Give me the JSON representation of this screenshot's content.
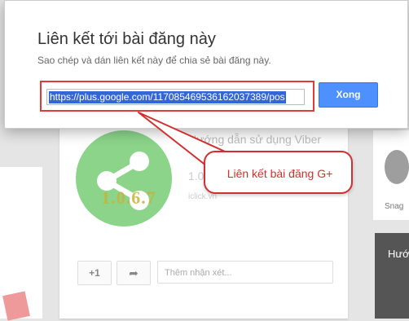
{
  "dialog": {
    "title": "Liên kết tới bài đăng này",
    "subtitle": "Sao chép và dán liên kết này để chia sẻ bài đăng này.",
    "url_value": "https://plus.google.com/117085469536162037389/pos",
    "done_label": "Xong"
  },
  "callout": {
    "text": "Liên kết bài đăng G+"
  },
  "background_post": {
    "title": "Hướng dẫn sử dụng Viber",
    "version": "1.0.6.7",
    "domain": "iclick.vn",
    "image_version": "1.0.6.7",
    "plusone_label": "+1",
    "comment_placeholder": "Thêm nhận xét..."
  },
  "right_card": {
    "name_snippet": "Snag",
    "dark_text": "Hướ"
  },
  "colors": {
    "accent_blue": "#4d90fe",
    "highlight_red": "#e53935"
  }
}
